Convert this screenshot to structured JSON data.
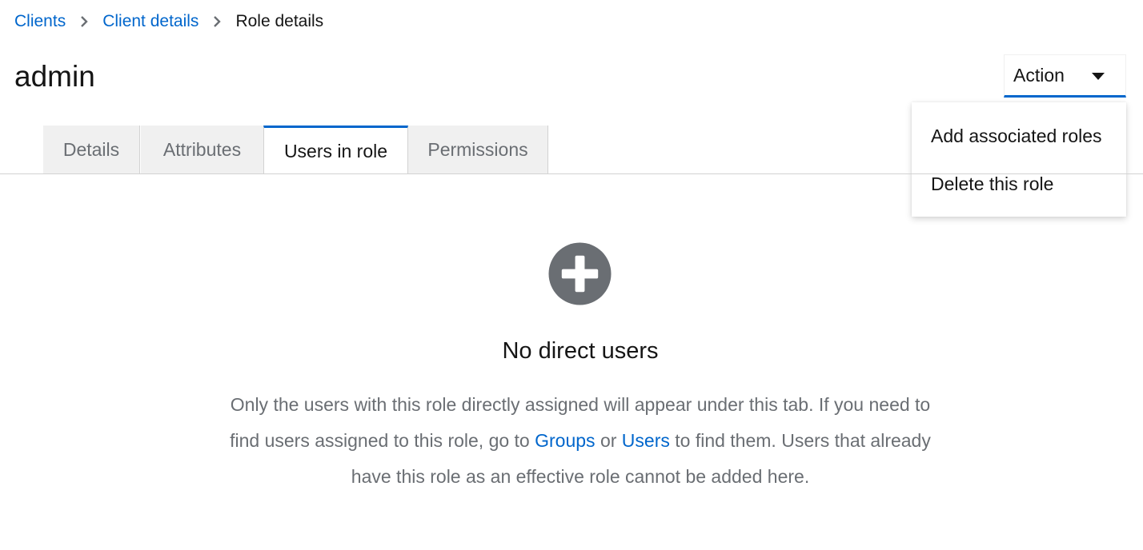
{
  "breadcrumb": {
    "items": [
      {
        "label": "Clients"
      },
      {
        "label": "Client details"
      },
      {
        "label": "Role details"
      }
    ]
  },
  "page": {
    "title": "admin"
  },
  "action": {
    "label": "Action",
    "menu": [
      {
        "label": "Add associated roles"
      },
      {
        "label": "Delete this role"
      }
    ]
  },
  "tabs": [
    {
      "label": "Details",
      "active": false
    },
    {
      "label": "Attributes",
      "active": false
    },
    {
      "label": "Users in role",
      "active": true
    },
    {
      "label": "Permissions",
      "active": false
    }
  ],
  "empty_state": {
    "icon": "plus-circle-icon",
    "title": "No direct users",
    "body_part1": "Only the users with this role directly assigned will appear under this tab. If you need to find users assigned to this role, go to ",
    "link_groups": "Groups",
    "body_or": " or ",
    "link_users": "Users",
    "body_part2": " to find them. Users that already have this role as an effective role cannot be added here."
  },
  "colors": {
    "link": "#0066cc",
    "active_tab_border": "#0066cc",
    "icon_gray": "#6a6e73"
  }
}
